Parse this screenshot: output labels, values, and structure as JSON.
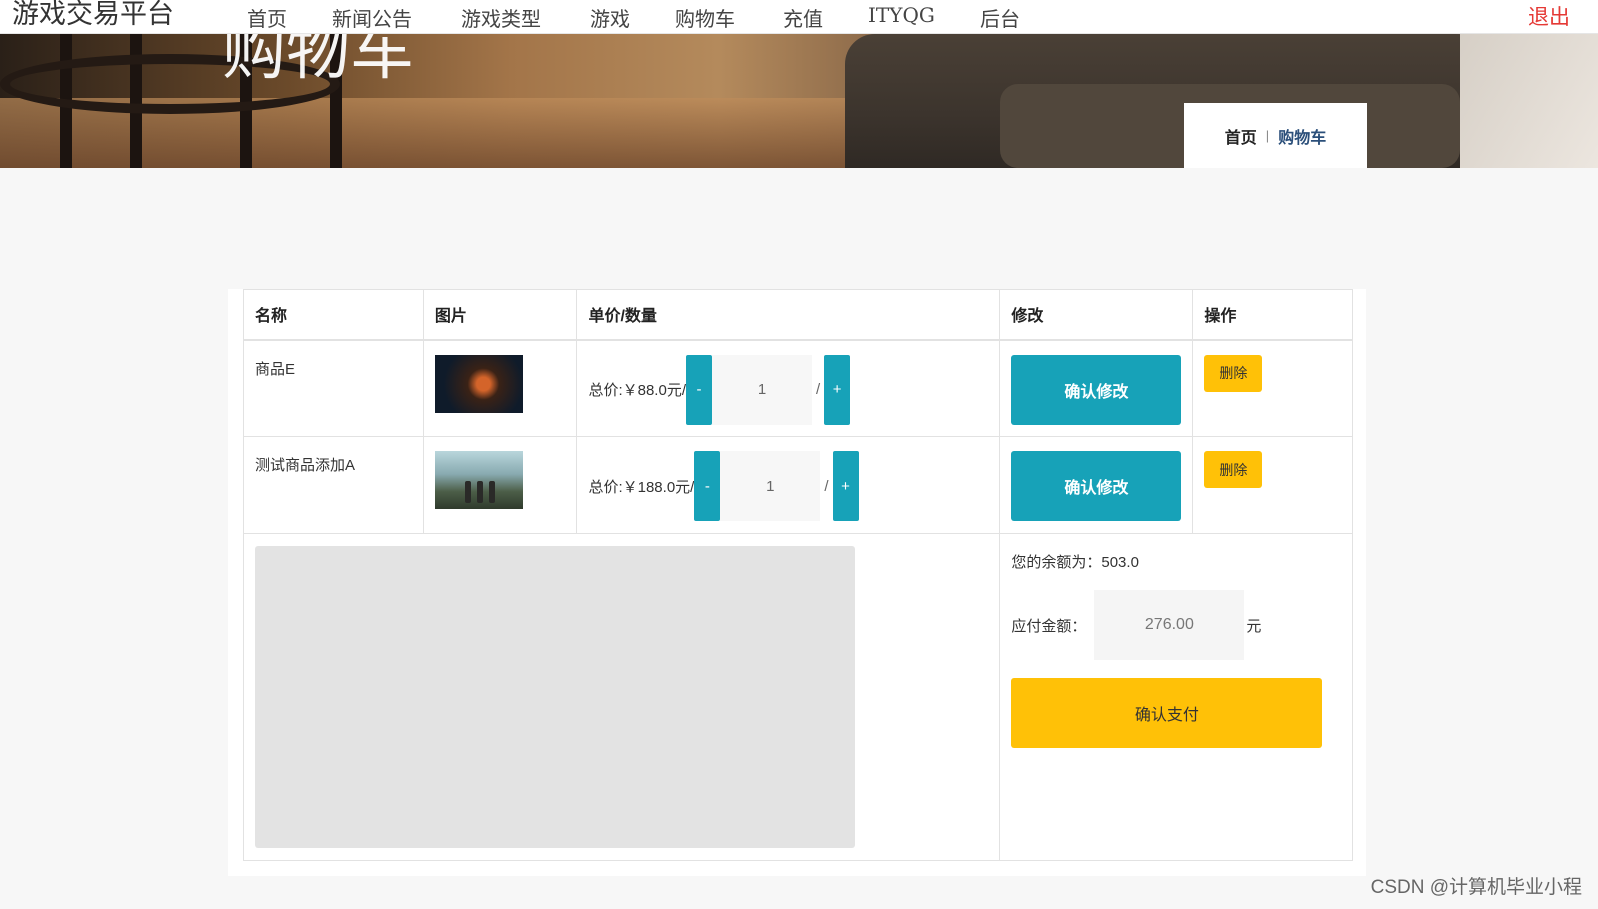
{
  "nav": {
    "brand": "游戏交易平台",
    "links": [
      "首页",
      "新闻公告",
      "游戏类型",
      "游戏",
      "购物车",
      "充值",
      "ITYQG",
      "后台"
    ],
    "logout": "退出"
  },
  "banner": {
    "title": "购物车"
  },
  "breadcrumb": {
    "home": "首页",
    "separator": "|",
    "current": "购物车"
  },
  "cart": {
    "headers": [
      "名称",
      "图片",
      "单价/数量",
      "修改",
      "操作"
    ],
    "items": [
      {
        "name": "商品E",
        "price_label": "总价:￥88.0元/",
        "minus": "-",
        "quantity": "1",
        "slash": "/",
        "plus": "+",
        "confirm_label": "确认修改",
        "delete_label": "删除"
      },
      {
        "name": "测试商品添加A",
        "price_label": "总价:￥188.0元/",
        "minus": "-",
        "quantity": "1",
        "slash": "/",
        "plus": "+",
        "confirm_label": "确认修改",
        "delete_label": "删除"
      }
    ],
    "balance_label": "您的余额为：",
    "balance_value": "503.0",
    "payable_label": "应付金额：",
    "payable_value": "276.00",
    "payable_unit": "元",
    "pay_button": "确认支付"
  },
  "watermark": "CSDN @计算机毕业小程",
  "colors": {
    "teal": "#17a2b8",
    "yellow": "#ffc107",
    "logout_red": "#e53935"
  }
}
